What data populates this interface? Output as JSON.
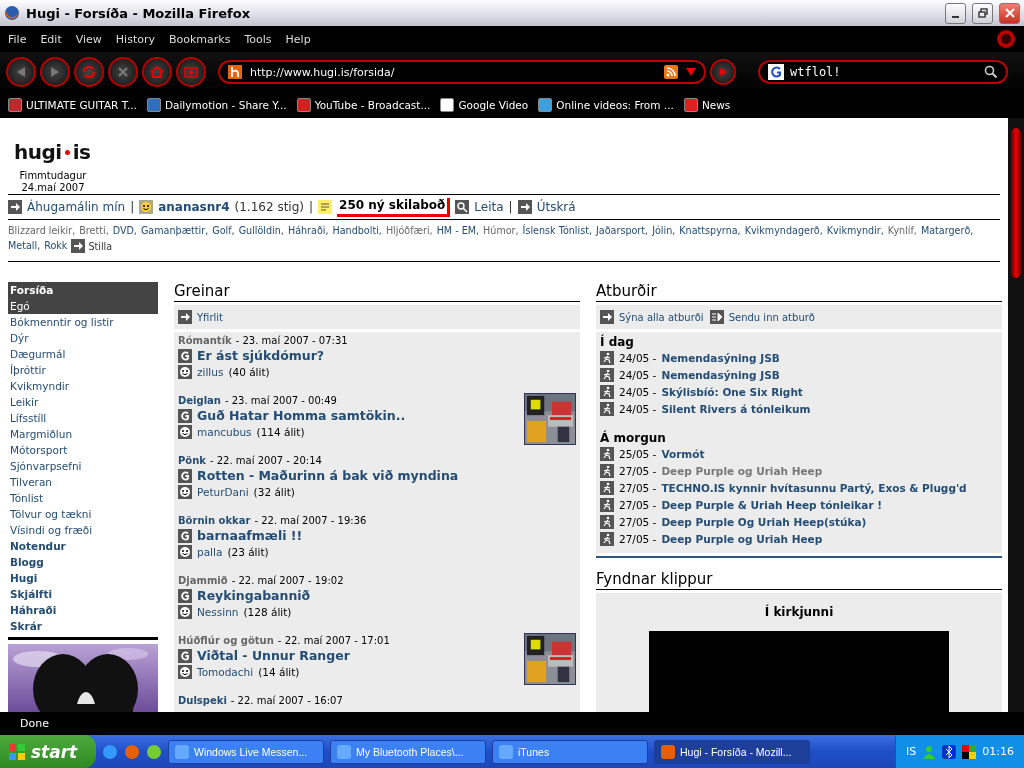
{
  "window": {
    "title": "Hugi - Forsíða - Mozilla Firefox"
  },
  "menu": [
    "File",
    "Edit",
    "View",
    "History",
    "Bookmarks",
    "Tools",
    "Help"
  ],
  "address": {
    "value": "http://www.hugi.is/forsida/"
  },
  "search": {
    "value": "wtflol!"
  },
  "bookmarks": [
    {
      "label": "ULTIMATE GUITAR T...",
      "color": "#c0282d"
    },
    {
      "label": "Dailymotion - Share Y...",
      "color": "#2f6fc0"
    },
    {
      "label": "YouTube - Broadcast...",
      "color": "#d42020"
    },
    {
      "label": "Google Video",
      "color": "#ffffff"
    },
    {
      "label": "Online videos: From ...",
      "color": "#3aa0e0"
    },
    {
      "label": "News",
      "color": "#e02020"
    }
  ],
  "page": {
    "logo": {
      "left": "hugi",
      "right": "is"
    },
    "date": [
      "Fimmtudagur",
      "24.maí 2007"
    ],
    "userbar": [
      {
        "kind": "nav",
        "label": "Áhugamálin mín"
      },
      {
        "kind": "sep",
        "label": "|"
      },
      {
        "kind": "user",
        "label": "ananasnr4",
        "extra": "(1.162 stig)"
      },
      {
        "kind": "sep",
        "label": "|"
      },
      {
        "kind": "messages",
        "label": "250 ný skilaboð",
        "highlighted": true
      },
      {
        "kind": "search",
        "label": "Leita"
      },
      {
        "kind": "sep",
        "label": "|"
      },
      {
        "kind": "nav",
        "label": "Útskrá"
      }
    ],
    "categories": [
      {
        "label": "Blizzard leikir,",
        "muted": true
      },
      {
        "label": "Bretti,",
        "muted": true
      },
      {
        "label": "DVD,",
        "muted": false
      },
      {
        "label": "Gamanþættir,",
        "muted": false
      },
      {
        "label": "Golf,",
        "muted": false
      },
      {
        "label": "Gullöldin,",
        "muted": false
      },
      {
        "label": "Háhraði,",
        "muted": false
      },
      {
        "label": "Handbolti,",
        "muted": false
      },
      {
        "label": "Hljóðfæri,",
        "muted": true
      },
      {
        "label": "HM - EM,",
        "muted": false
      },
      {
        "label": "Húmor,",
        "muted": true
      },
      {
        "label": "Íslensk Tónlist,",
        "muted": false
      },
      {
        "label": "Jaðarsport,",
        "muted": false
      },
      {
        "label": "Jólin,",
        "muted": false
      },
      {
        "label": "Knattspyrna,",
        "muted": false
      },
      {
        "label": "Kvikmyndagerð,",
        "muted": false
      },
      {
        "label": "Kvikmyndir,",
        "muted": false
      },
      {
        "label": "Kynlíf,",
        "muted": true
      },
      {
        "label": "Matargerð,",
        "muted": false
      },
      {
        "label": "Metall,",
        "muted": false
      },
      {
        "label": "Rokk",
        "muted": false
      }
    ],
    "settings": "Stilla",
    "sidebar": {
      "items": [
        {
          "label": "Forsíða",
          "kind": "current"
        },
        {
          "label": "Egó",
          "kind": "sub"
        },
        {
          "label": "Bókmenntir og listir",
          "kind": "link"
        },
        {
          "label": "Dýr",
          "kind": "link"
        },
        {
          "label": "Dægurmál",
          "kind": "link"
        },
        {
          "label": "Íþróttir",
          "kind": "link"
        },
        {
          "label": "Kvikmyndir",
          "kind": "link"
        },
        {
          "label": "Leikir",
          "kind": "link"
        },
        {
          "label": "Lífsstíll",
          "kind": "link"
        },
        {
          "label": "Margmiðlun",
          "kind": "link"
        },
        {
          "label": "Mótorsport",
          "kind": "link"
        },
        {
          "label": "Sjónvarpsefni",
          "kind": "link"
        },
        {
          "label": "Tilveran",
          "kind": "link"
        },
        {
          "label": "Tónlist",
          "kind": "link"
        },
        {
          "label": "Tölvur og tækni",
          "kind": "link"
        },
        {
          "label": "Vísindi og fræði",
          "kind": "link"
        },
        {
          "label": "Notendur",
          "kind": "strong"
        },
        {
          "label": "Blogg",
          "kind": "strong"
        },
        {
          "label": "Hugi",
          "kind": "strong"
        },
        {
          "label": "Skjálfti",
          "kind": "strong"
        },
        {
          "label": "Háhraði",
          "kind": "strong"
        },
        {
          "label": "Skrár",
          "kind": "strong"
        }
      ]
    },
    "articles": {
      "heading": "Greinar",
      "links": [
        {
          "kind": "nav",
          "label": "Yfirlit"
        }
      ],
      "items": [
        {
          "category": "Rómantík",
          "muted": true,
          "date": "- 23. maí 2007 - 07:31",
          "title": "Er ást sjúkdómur?",
          "author": "zillus",
          "comments": "(40 álit)",
          "picture": false
        },
        {
          "category": "Deiglan",
          "muted": false,
          "date": "- 23. maí 2007 - 00:49",
          "title": "Guð Hatar Homma samtökin..",
          "author": "mancubus",
          "comments": "(114 álit)",
          "picture": true
        },
        {
          "category": "Pönk",
          "muted": false,
          "date": "- 22. maí 2007 - 20:14",
          "title": "Rotten - Maðurinn á bak við myndina",
          "author": "PeturDani",
          "comments": "(32 álit)",
          "picture": false
        },
        {
          "category": "Börnin okkar",
          "muted": false,
          "date": "- 22. maí 2007 - 19:36",
          "title": "barnaafmæli !!",
          "author": "palla",
          "comments": "(23 álit)",
          "picture": false
        },
        {
          "category": "Djammið",
          "muted": true,
          "date": "- 22. maí 2007 - 19:02",
          "title": "Reykingabannið",
          "author": "Nessinn",
          "comments": "(128 álit)",
          "picture": false
        },
        {
          "category": "Húðflúr og götun",
          "muted": true,
          "date": "- 22. maí 2007 - 17:01",
          "title": "Viðtal - Unnur Ranger",
          "author": "Tomodachi",
          "comments": "(14 álit)",
          "picture": true
        },
        {
          "category": "Dulspeki",
          "muted": false,
          "date": "- 22. maí 2007 - 16:07",
          "picture": false
        }
      ]
    },
    "events": {
      "heading": "Atburðir",
      "links": [
        {
          "kind": "nav",
          "label": "Sýna alla atburði"
        },
        {
          "kind": "submit",
          "label": "Sendu inn atburð"
        }
      ],
      "groups": [
        {
          "heading": "Í dag",
          "items": [
            {
              "date": "24/05 -",
              "title": "Nemendasýning JSB",
              "muted": false
            },
            {
              "date": "24/05 -",
              "title": "Nemendasýning JSB",
              "muted": false
            },
            {
              "date": "24/05 -",
              "title": "Skýlisbíó: One Six Right",
              "muted": false
            },
            {
              "date": "24/05 -",
              "title": "Silent Rivers á tónleikum",
              "muted": false
            }
          ]
        },
        {
          "heading": "Á morgun",
          "items": [
            {
              "date": "25/05 -",
              "title": "Vormót",
              "muted": false
            },
            {
              "date": "27/05 -",
              "title": "Deep Purple og Uriah Heep",
              "muted": true
            },
            {
              "date": "27/05 -",
              "title": "TECHNO.IS kynnir hvítasunnu Partý, Exos & Plugg'd",
              "muted": false
            },
            {
              "date": "27/05 -",
              "title": "Deep Purple & Uriah Heep tónleikar !",
              "muted": false
            },
            {
              "date": "27/05 -",
              "title": "Deep Purple Og Uriah Heep(stúka)",
              "muted": false
            },
            {
              "date": "27/05 -",
              "title": "Deep Purple og Uriah Heep",
              "muted": false
            }
          ]
        }
      ]
    },
    "clips": {
      "heading": "Fyndnar klippur",
      "title": "Í kirkjunni"
    }
  },
  "status_bar": "Done",
  "taskbar": {
    "start": "start",
    "tasks": [
      {
        "label": "Windows Live Messen...",
        "selected": false
      },
      {
        "label": "My Bluetooth Places\\...",
        "selected": false
      },
      {
        "label": "iTunes",
        "selected": false
      },
      {
        "label": "Hugi - Forsíða - Mozill...",
        "selected": true
      }
    ],
    "language": "IS",
    "clock": "01:16"
  }
}
